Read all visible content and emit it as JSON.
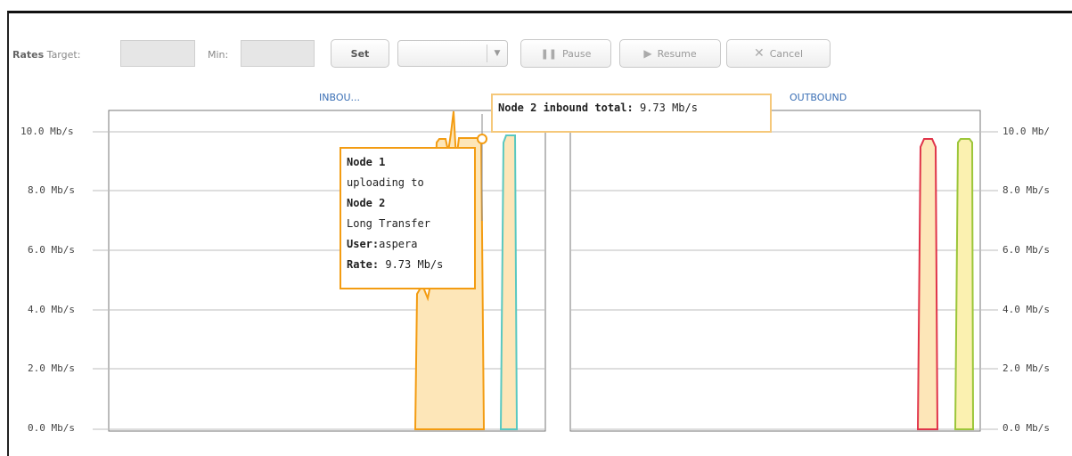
{
  "toolbar": {
    "rates_label": "Rates",
    "target_label": "Target:",
    "target_value": "",
    "min_label": "Min:",
    "min_value": "",
    "set_label": "Set",
    "select_value": "",
    "pause_label": "Pause",
    "resume_label": "Resume",
    "cancel_label": "Cancel"
  },
  "charts": {
    "inbound_title": "INBOU...",
    "outbound_title": "OUTBOUND",
    "y_ticks": [
      "10.0 Mb/s",
      "8.0 Mb/s",
      "6.0 Mb/s",
      "4.0 Mb/s",
      "2.0 Mb/s",
      "0.0 Mb/s"
    ],
    "y_ticks_right": [
      "10.0 Mb/",
      "8.0 Mb/s",
      "6.0 Mb/s",
      "4.0 Mb/s",
      "2.0 Mb/s",
      "0.0 Mb/s"
    ]
  },
  "tooltip_transfer": {
    "source": "Node 1",
    "verb": "uploading to",
    "dest": "Node 2",
    "name": "Long Transfer",
    "user_label": "User:",
    "user_value": "aspera",
    "rate_label": "Rate:",
    "rate_value": "9.73 Mb/s"
  },
  "tooltip_total": {
    "label": "Node 2 inbound total:",
    "value": "9.73 Mb/s"
  },
  "chart_data": [
    {
      "type": "area",
      "title": "INBOU...",
      "ylabel": "",
      "ylim": [
        0,
        10.0
      ],
      "series": [
        {
          "name": "Node 1 uploading to Node 2",
          "color": "#f39c12",
          "peak": 9.73
        },
        {
          "color": "#5ac8c0",
          "peak": 9.73
        }
      ]
    },
    {
      "type": "area",
      "title": "OUTBOUND",
      "ylabel": "",
      "ylim": [
        0,
        10.0
      ],
      "series": [
        {
          "color": "#e0344a",
          "peak": 9.73
        },
        {
          "color": "#9cc63a",
          "peak": 9.73
        }
      ]
    }
  ]
}
